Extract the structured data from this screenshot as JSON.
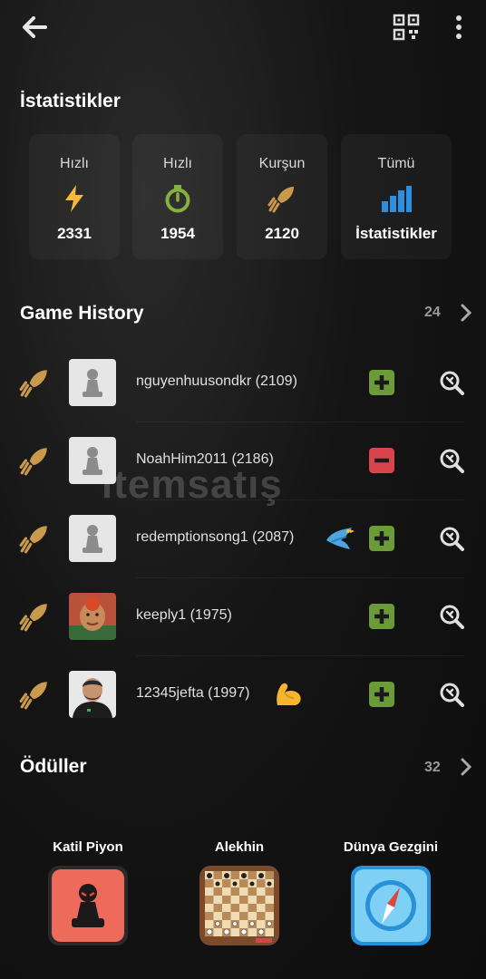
{
  "nav": {
    "back_icon": "arrow-left-icon",
    "qr_icon": "qr-code-icon",
    "more_icon": "more-vertical-icon"
  },
  "stats": {
    "title": "İstatistikler",
    "items": [
      {
        "label": "Hızlı",
        "value": "2331",
        "icon": "lightning-icon",
        "color": "#f6b73c"
      },
      {
        "label": "Hızlı",
        "value": "1954",
        "icon": "stopwatch-icon",
        "color": "#86b13e"
      },
      {
        "label": "Kurşun",
        "value": "2120",
        "icon": "bullet-icon",
        "color": "#c99a4e"
      },
      {
        "label": "Tümü",
        "value": "İstatistikler",
        "icon": "bar-chart-icon",
        "color": "#2a8fe0"
      }
    ]
  },
  "game_history": {
    "title": "Game History",
    "count": "24",
    "games": [
      {
        "player": "nguyenhuusondkr (2109)",
        "result": "win",
        "avatar": "pawn-avatar",
        "emoji": ""
      },
      {
        "player": "NoahHim2011 (2186)",
        "result": "loss",
        "avatar": "pawn-avatar",
        "emoji": ""
      },
      {
        "player": "redemptionsong1 (2087)",
        "result": "win",
        "avatar": "pawn-avatar",
        "emoji": "dove-icon"
      },
      {
        "player": "keeply1 (1975)",
        "result": "win",
        "avatar": "photo-avatar",
        "emoji": ""
      },
      {
        "player": "12345jefta (1997)",
        "result": "win",
        "avatar": "photo-avatar",
        "emoji": "flexed-biceps-icon"
      }
    ]
  },
  "awards": {
    "title": "Ödüller",
    "count": "32",
    "items": [
      {
        "name": "Katil Piyon",
        "icon": "killer-pawn-icon"
      },
      {
        "name": "Alekhin",
        "icon": "chess-board-icon"
      },
      {
        "name": "Dünya Gezgini",
        "icon": "compass-icon"
      }
    ]
  },
  "watermark": "itemsatış",
  "colors": {
    "win": "#6b9b37",
    "loss": "#d9434b",
    "bg": "#151515"
  }
}
